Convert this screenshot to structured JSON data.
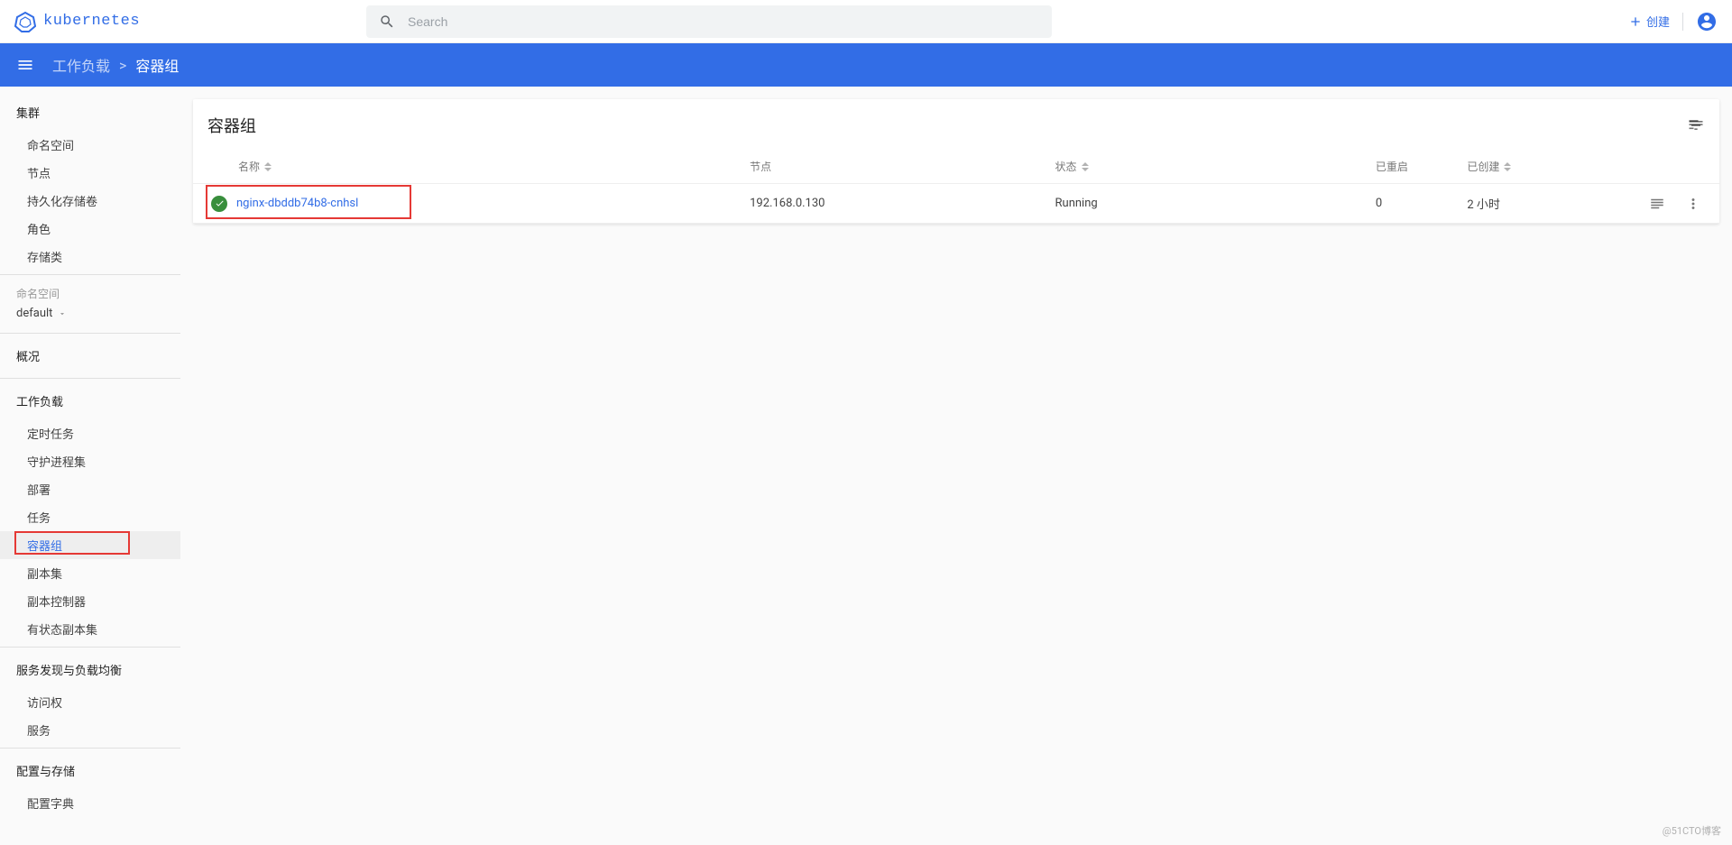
{
  "header": {
    "logo_text": "kubernetes",
    "search_placeholder": "Search",
    "create_label": "创建"
  },
  "breadcrumb": {
    "parent": "工作负载",
    "separator": ">",
    "current": "容器组"
  },
  "sidebar": {
    "cluster_section": "集群",
    "cluster_items": [
      "命名空间",
      "节点",
      "持久化存储卷",
      "角色",
      "存储类"
    ],
    "namespace_label": "命名空间",
    "namespace_value": "default",
    "overview": "概况",
    "workloads_section": "工作负载",
    "workloads_items": [
      "定时任务",
      "守护进程集",
      "部署",
      "任务",
      "容器组",
      "副本集",
      "副本控制器",
      "有状态副本集"
    ],
    "selected_workload": "容器组",
    "discovery_section": "服务发现与负载均衡",
    "discovery_items": [
      "访问权",
      "服务"
    ],
    "config_section": "配置与存储",
    "config_items": [
      "配置字典"
    ]
  },
  "card": {
    "title": "容器组"
  },
  "table": {
    "columns": {
      "name": "名称",
      "node": "节点",
      "status": "状态",
      "restarts": "已重启",
      "created": "已创建"
    },
    "rows": [
      {
        "name": "nginx-dbddb74b8-cnhsl",
        "node": "192.168.0.130",
        "status": "Running",
        "restarts": "0",
        "created": "2 小时"
      }
    ]
  },
  "watermark": "@51CTO博客"
}
